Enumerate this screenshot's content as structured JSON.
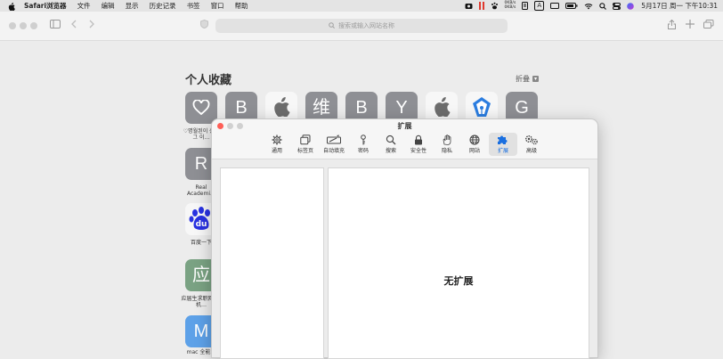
{
  "menubar": {
    "items": [
      "Safari浏览器",
      "文件",
      "编辑",
      "显示",
      "历史记录",
      "书签",
      "窗口",
      "帮助"
    ],
    "net_speed_up": "0KB/s",
    "net_speed_down": "0KB/s",
    "input_method": "A",
    "datetime": "5月17日 周一 下午10:31"
  },
  "toolbar": {
    "search_placeholder": "搜索或输入网站名称"
  },
  "favorites": {
    "title": "个人收藏",
    "collapse_label": "折叠",
    "tiles": [
      {
        "letter": "",
        "icon": "heart-icon",
        "style": "gray"
      },
      {
        "letter": "B",
        "style": "gray"
      },
      {
        "letter": "",
        "icon": "apple-logo-icon",
        "style": "light"
      },
      {
        "letter": "维",
        "style": "gray"
      },
      {
        "letter": "B",
        "style": "gray"
      },
      {
        "letter": "Y",
        "style": "gray"
      },
      {
        "letter": "",
        "icon": "apple-logo-icon",
        "style": "light"
      },
      {
        "letter": "",
        "icon": "pen-nib-icon",
        "style": "light"
      },
      {
        "letter": "G",
        "style": "gray"
      }
    ],
    "col_tiles": [
      {
        "letter": "R",
        "label": "Real Academi…"
      },
      {
        "letter": "du",
        "label": "百度一下"
      },
      {
        "letter": "应",
        "label": "应届生求职网_手机…"
      },
      {
        "letter": "M",
        "label": "mac 全能…"
      }
    ],
    "first_label": "♡명월된이 상상 그 이…"
  },
  "prefs": {
    "title": "扩展",
    "tabs": [
      "通用",
      "标签页",
      "自动填充",
      "密码",
      "搜索",
      "安全性",
      "隐私",
      "网站",
      "扩展",
      "高级"
    ],
    "active_tab": "扩展",
    "empty_text": "无扩展"
  },
  "colors": {
    "accent": "#1a6fe0",
    "close": "#fe5f57",
    "inactive_dot": "#d0d0d0"
  }
}
